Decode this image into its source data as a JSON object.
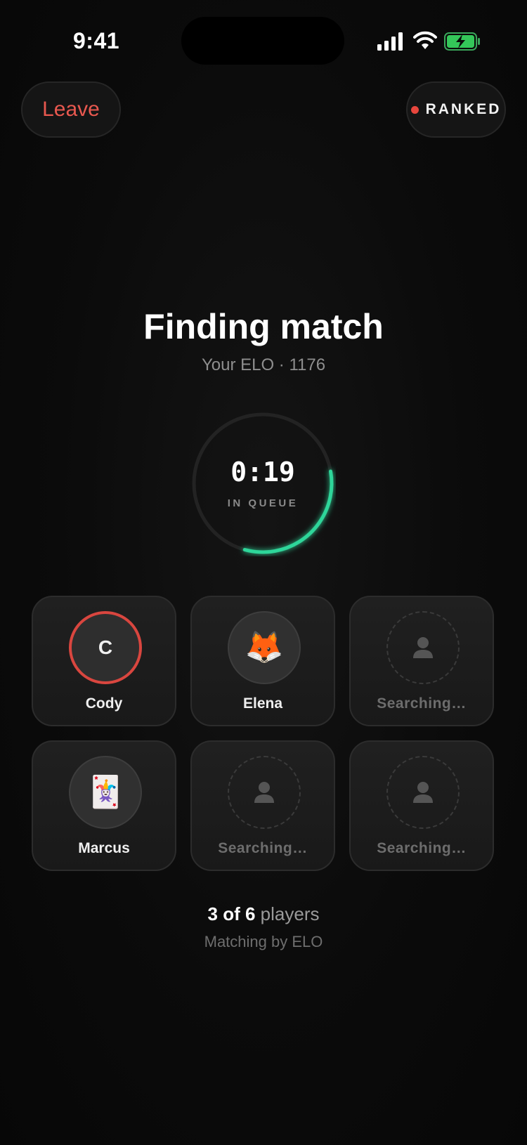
{
  "status_bar": {
    "time": "9:41"
  },
  "header": {
    "leave_label": "Leave",
    "mode_badge": "RANKED",
    "mode_dot_color": "#e8463d"
  },
  "main": {
    "title": "Finding match",
    "elo_line": "Your ELO · 1176",
    "timer": {
      "value": "0:19",
      "label": "IN QUEUE",
      "progress": 0.32,
      "accent": "#2fd69a"
    },
    "players": [
      {
        "name": "Cody",
        "avatar": "C",
        "type": "initial",
        "status": "joined"
      },
      {
        "name": "Elena",
        "avatar": "🦊",
        "type": "emoji",
        "status": "joined"
      },
      {
        "name": "Searching…",
        "type": "empty",
        "status": "searching"
      },
      {
        "name": "Marcus",
        "avatar": "🃏",
        "type": "emoji",
        "status": "joined"
      },
      {
        "name": "Searching…",
        "type": "empty",
        "status": "searching"
      },
      {
        "name": "Searching…",
        "type": "empty",
        "status": "searching"
      }
    ],
    "players_count_strong": "3 of 6",
    "players_count_suffix": " players",
    "matching_note": "Matching by ELO"
  }
}
